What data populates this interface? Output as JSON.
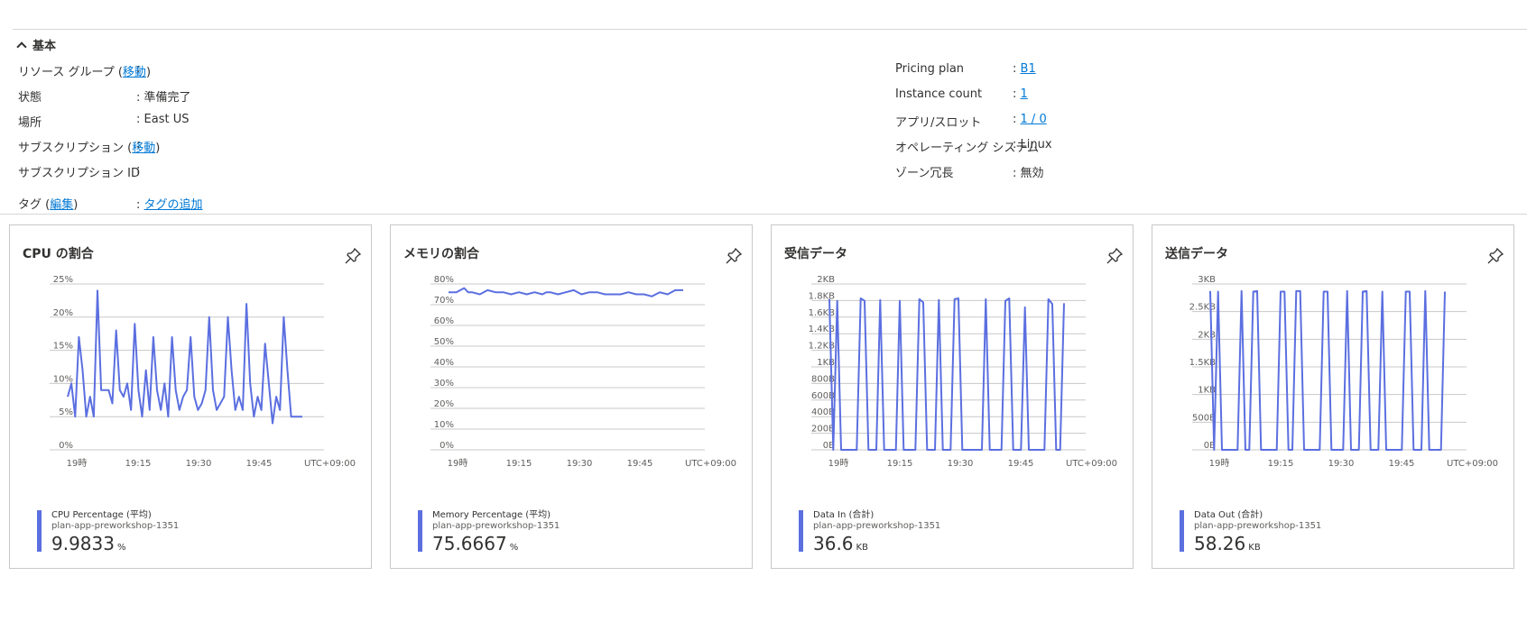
{
  "essentials": {
    "header": "基本",
    "left": [
      {
        "label": "リソース グループ (",
        "link": "移動",
        "label_after": ")",
        "value": ""
      },
      {
        "label": "状態",
        "value": "準備完了"
      },
      {
        "label": "場所",
        "value": "East US"
      },
      {
        "label": "サブスクリプション (",
        "link": "移動",
        "label_after": ")",
        "value": ""
      },
      {
        "label": "サブスクリプション ID",
        "value": ""
      }
    ],
    "tags": {
      "label": "タグ (",
      "link": "編集",
      "label_after": ")",
      "value_link": "タグの追加"
    },
    "right": [
      {
        "label": "Pricing plan",
        "value_link": "B1"
      },
      {
        "label": "Instance count",
        "value_link": "1"
      },
      {
        "label": "アプリ/スロット",
        "value_link": "1 / 0"
      },
      {
        "label": "オペレーティング システム",
        "value": "Linux"
      },
      {
        "label": "ゾーン冗長",
        "value": "無効"
      }
    ],
    "separator": ":"
  },
  "colors": {
    "series": "#5b6fe0",
    "grid": "#c8c8c8",
    "link": "#0078d4"
  },
  "tiles": [
    {
      "title": "CPU の割合",
      "pin_icon": "pin-icon",
      "legend": {
        "name": "CPU Percentage (平均)",
        "resource": "plan-app-preworkshop-1351",
        "value": "9.9833",
        "unit": "%"
      }
    },
    {
      "title": "メモリの割合",
      "pin_icon": "pin-icon",
      "legend": {
        "name": "Memory Percentage (平均)",
        "resource": "plan-app-preworkshop-1351",
        "value": "75.6667",
        "unit": "%"
      }
    },
    {
      "title": "受信データ",
      "pin_icon": "pin-icon",
      "legend": {
        "name": "Data In (合計)",
        "resource": "plan-app-preworkshop-1351",
        "value": "36.6",
        "unit": "KB"
      }
    },
    {
      "title": "送信データ",
      "pin_icon": "pin-icon",
      "legend": {
        "name": "Data Out (合計)",
        "resource": "plan-app-preworkshop-1351",
        "value": "58.26",
        "unit": "KB"
      }
    }
  ],
  "chart_data": [
    {
      "type": "line",
      "title": "CPU の割合",
      "x_tick_labels": [
        "19時",
        "19:15",
        "19:30",
        "19:45",
        "UTC+09:00"
      ],
      "x_range_minutes": [
        0,
        63
      ],
      "y_tick_labels": [
        "0%",
        "5%",
        "10%",
        "15%",
        "20%",
        "25%"
      ],
      "ylim": [
        0,
        25
      ],
      "grid": true,
      "series": [
        {
          "name": "CPU Percentage (平均)",
          "x": [
            0,
            1,
            2,
            3,
            4,
            5,
            6,
            7,
            8,
            9,
            10,
            11,
            12,
            13,
            14,
            15,
            16,
            17,
            18,
            19,
            20,
            21,
            22,
            23,
            24,
            25,
            26,
            27,
            28,
            29,
            30,
            31,
            32,
            33,
            34,
            35,
            36,
            37,
            38,
            39,
            40,
            41,
            42,
            43,
            44,
            45,
            46,
            47,
            48,
            49,
            50,
            51,
            52,
            53,
            54,
            55,
            56,
            57,
            58,
            59,
            60,
            61,
            62,
            63
          ],
          "values": [
            8,
            10,
            5,
            17,
            12,
            5,
            8,
            5,
            24,
            9,
            9,
            9,
            7,
            18,
            9,
            8,
            10,
            6,
            19,
            9,
            5,
            12,
            6,
            17,
            9,
            6,
            10,
            5,
            17,
            9,
            6,
            8,
            9,
            17,
            8,
            6,
            7,
            9,
            20,
            9,
            6,
            7,
            8,
            20,
            12,
            6,
            8,
            6,
            22,
            10,
            5,
            8,
            6,
            16,
            10,
            4,
            8,
            6,
            20,
            12,
            5,
            5,
            5,
            5
          ]
        }
      ]
    },
    {
      "type": "line",
      "title": "メモリの割合",
      "x_tick_labels": [
        "19時",
        "19:15",
        "19:30",
        "19:45",
        "UTC+09:00"
      ],
      "x_range_minutes": [
        0,
        60
      ],
      "y_tick_labels": [
        "0%",
        "10%",
        "20%",
        "30%",
        "40%",
        "50%",
        "60%",
        "70%",
        "80%"
      ],
      "ylim": [
        0,
        80
      ],
      "grid": true,
      "series": [
        {
          "name": "Memory Percentage (平均)",
          "x": [
            0,
            2,
            4,
            5,
            6,
            8,
            10,
            12,
            14,
            16,
            18,
            20,
            22,
            24,
            25,
            26,
            28,
            30,
            32,
            34,
            36,
            38,
            40,
            42,
            44,
            46,
            48,
            50,
            52,
            54,
            56,
            58,
            60
          ],
          "values": [
            76,
            76,
            78,
            76,
            76,
            75,
            77,
            76,
            76,
            75,
            76,
            75,
            76,
            75,
            76,
            76,
            75,
            76,
            77,
            75,
            76,
            76,
            75,
            75,
            75,
            76,
            75,
            75,
            74,
            76,
            75,
            77,
            77
          ]
        }
      ]
    },
    {
      "type": "line",
      "title": "受信データ",
      "x_tick_labels": [
        "19時",
        "19:15",
        "19:30",
        "19:45",
        "UTC+09:00"
      ],
      "x_range_minutes": [
        0,
        60
      ],
      "y_tick_labels": [
        "0B",
        "200B",
        "400B",
        "600B",
        "800B",
        "1KB",
        "1.2KB",
        "1.4KB",
        "1.6KB",
        "1.8KB",
        "2KB"
      ],
      "ylim": [
        0,
        2048
      ],
      "grid": true,
      "series": [
        {
          "name": "Data In (合計)",
          "x": [
            0,
            1,
            2,
            3,
            4,
            5,
            6,
            7,
            8,
            9,
            10,
            11,
            12,
            13,
            14,
            15,
            16,
            17,
            18,
            19,
            20,
            21,
            22,
            23,
            24,
            25,
            26,
            27,
            28,
            29,
            30,
            31,
            32,
            33,
            34,
            35,
            36,
            37,
            38,
            39,
            40,
            41,
            42,
            43,
            44,
            45,
            46,
            47,
            48,
            49,
            50,
            51,
            52,
            53,
            54,
            55,
            56,
            57,
            58,
            59,
            60
          ],
          "values": [
            1860,
            0,
            1840,
            0,
            0,
            0,
            0,
            0,
            1870,
            1840,
            0,
            0,
            0,
            1850,
            0,
            0,
            0,
            0,
            1840,
            0,
            0,
            0,
            0,
            1860,
            1820,
            0,
            0,
            0,
            1850,
            0,
            0,
            0,
            1860,
            1870,
            0,
            0,
            0,
            0,
            0,
            0,
            1860,
            0,
            0,
            0,
            0,
            1840,
            1870,
            0,
            0,
            0,
            1760,
            0,
            0,
            0,
            0,
            0,
            1860,
            1800,
            0,
            0,
            1810
          ]
        }
      ]
    },
    {
      "type": "line",
      "title": "送信データ",
      "x_tick_labels": [
        "19時",
        "19:15",
        "19:30",
        "19:45",
        "UTC+09:00"
      ],
      "x_range_minutes": [
        0,
        60
      ],
      "y_tick_labels": [
        "0B",
        "500B",
        "1KB",
        "1.5KB",
        "2KB",
        "2.5KB",
        "3KB"
      ],
      "ylim": [
        0,
        3072
      ],
      "grid": true,
      "series": [
        {
          "name": "Data Out (合計)",
          "x": [
            0,
            1,
            2,
            3,
            4,
            5,
            6,
            7,
            8,
            9,
            10,
            11,
            12,
            13,
            14,
            15,
            16,
            17,
            18,
            19,
            20,
            21,
            22,
            23,
            24,
            25,
            26,
            27,
            28,
            29,
            30,
            31,
            32,
            33,
            34,
            35,
            36,
            37,
            38,
            39,
            40,
            41,
            42,
            43,
            44,
            45,
            46,
            47,
            48,
            49,
            50,
            51,
            52,
            53,
            54,
            55,
            56,
            57,
            58,
            59,
            60
          ],
          "values": [
            2940,
            0,
            2930,
            0,
            0,
            0,
            0,
            0,
            2940,
            0,
            0,
            2930,
            2940,
            0,
            0,
            0,
            0,
            0,
            2930,
            2930,
            0,
            0,
            2940,
            2940,
            0,
            0,
            0,
            0,
            0,
            2930,
            2930,
            0,
            0,
            0,
            0,
            2940,
            0,
            0,
            0,
            2930,
            2940,
            0,
            0,
            0,
            2930,
            0,
            0,
            0,
            0,
            0,
            2930,
            2930,
            0,
            0,
            0,
            2940,
            0,
            0,
            0,
            0,
            2930
          ]
        }
      ]
    }
  ]
}
